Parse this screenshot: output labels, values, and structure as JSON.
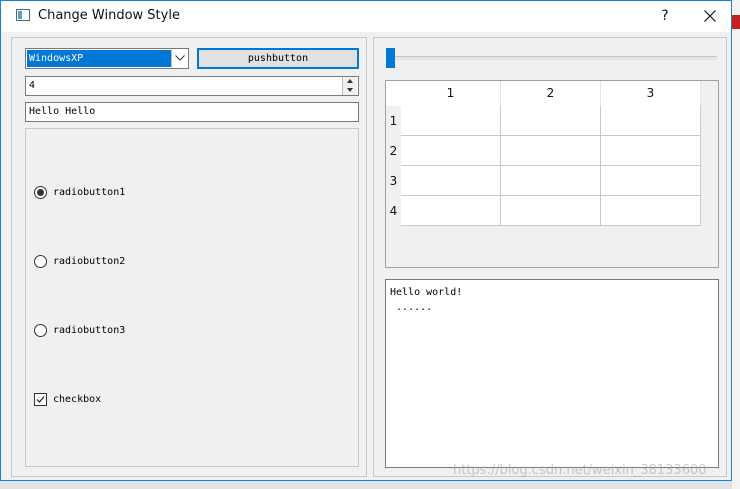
{
  "window": {
    "title": "Change Window Style",
    "help_label": "?"
  },
  "left": {
    "style_combo": {
      "selected": "WindowsXP"
    },
    "push_button_label": "pushbutton",
    "spinbox_value": "4",
    "line_edit_value": "Hello Hello",
    "radios": [
      {
        "label": "radiobutton1",
        "checked": true
      },
      {
        "label": "radiobutton2",
        "checked": false
      },
      {
        "label": "radiobutton3",
        "checked": false
      }
    ],
    "checkbox": {
      "label": "checkbox",
      "checked": true
    }
  },
  "right": {
    "slider_value_fraction": 0,
    "table": {
      "columns": [
        "1",
        "2",
        "3"
      ],
      "rows": [
        "1",
        "2",
        "3",
        "4"
      ]
    },
    "text_edit": {
      "lines": [
        "Hello world!",
        " ......"
      ]
    }
  },
  "watermark": "https://blog.csdn.net/weixin_38133600",
  "colors": {
    "accent": "#0078d7",
    "window_border": "#1883d7",
    "background": "#f0f0f0"
  }
}
